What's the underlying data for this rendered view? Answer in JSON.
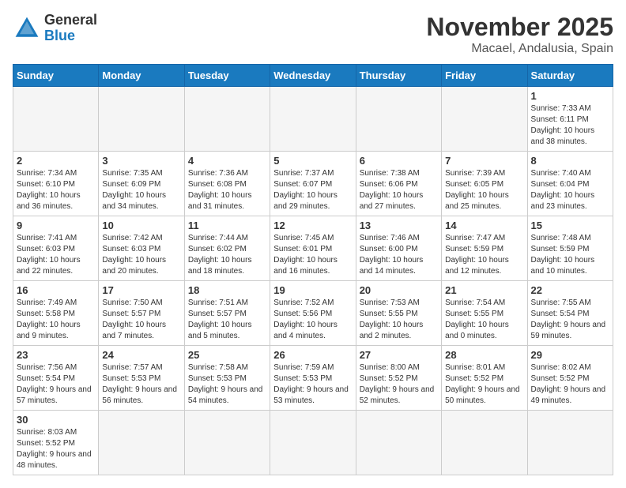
{
  "header": {
    "logo_general": "General",
    "logo_blue": "Blue",
    "month": "November 2025",
    "location": "Macael, Andalusia, Spain"
  },
  "weekdays": [
    "Sunday",
    "Monday",
    "Tuesday",
    "Wednesday",
    "Thursday",
    "Friday",
    "Saturday"
  ],
  "weeks": [
    [
      {
        "day": "",
        "info": ""
      },
      {
        "day": "",
        "info": ""
      },
      {
        "day": "",
        "info": ""
      },
      {
        "day": "",
        "info": ""
      },
      {
        "day": "",
        "info": ""
      },
      {
        "day": "",
        "info": ""
      },
      {
        "day": "1",
        "info": "Sunrise: 7:33 AM\nSunset: 6:11 PM\nDaylight: 10 hours and 38 minutes."
      }
    ],
    [
      {
        "day": "2",
        "info": "Sunrise: 7:34 AM\nSunset: 6:10 PM\nDaylight: 10 hours and 36 minutes."
      },
      {
        "day": "3",
        "info": "Sunrise: 7:35 AM\nSunset: 6:09 PM\nDaylight: 10 hours and 34 minutes."
      },
      {
        "day": "4",
        "info": "Sunrise: 7:36 AM\nSunset: 6:08 PM\nDaylight: 10 hours and 31 minutes."
      },
      {
        "day": "5",
        "info": "Sunrise: 7:37 AM\nSunset: 6:07 PM\nDaylight: 10 hours and 29 minutes."
      },
      {
        "day": "6",
        "info": "Sunrise: 7:38 AM\nSunset: 6:06 PM\nDaylight: 10 hours and 27 minutes."
      },
      {
        "day": "7",
        "info": "Sunrise: 7:39 AM\nSunset: 6:05 PM\nDaylight: 10 hours and 25 minutes."
      },
      {
        "day": "8",
        "info": "Sunrise: 7:40 AM\nSunset: 6:04 PM\nDaylight: 10 hours and 23 minutes."
      }
    ],
    [
      {
        "day": "9",
        "info": "Sunrise: 7:41 AM\nSunset: 6:03 PM\nDaylight: 10 hours and 22 minutes."
      },
      {
        "day": "10",
        "info": "Sunrise: 7:42 AM\nSunset: 6:03 PM\nDaylight: 10 hours and 20 minutes."
      },
      {
        "day": "11",
        "info": "Sunrise: 7:44 AM\nSunset: 6:02 PM\nDaylight: 10 hours and 18 minutes."
      },
      {
        "day": "12",
        "info": "Sunrise: 7:45 AM\nSunset: 6:01 PM\nDaylight: 10 hours and 16 minutes."
      },
      {
        "day": "13",
        "info": "Sunrise: 7:46 AM\nSunset: 6:00 PM\nDaylight: 10 hours and 14 minutes."
      },
      {
        "day": "14",
        "info": "Sunrise: 7:47 AM\nSunset: 5:59 PM\nDaylight: 10 hours and 12 minutes."
      },
      {
        "day": "15",
        "info": "Sunrise: 7:48 AM\nSunset: 5:59 PM\nDaylight: 10 hours and 10 minutes."
      }
    ],
    [
      {
        "day": "16",
        "info": "Sunrise: 7:49 AM\nSunset: 5:58 PM\nDaylight: 10 hours and 9 minutes."
      },
      {
        "day": "17",
        "info": "Sunrise: 7:50 AM\nSunset: 5:57 PM\nDaylight: 10 hours and 7 minutes."
      },
      {
        "day": "18",
        "info": "Sunrise: 7:51 AM\nSunset: 5:57 PM\nDaylight: 10 hours and 5 minutes."
      },
      {
        "day": "19",
        "info": "Sunrise: 7:52 AM\nSunset: 5:56 PM\nDaylight: 10 hours and 4 minutes."
      },
      {
        "day": "20",
        "info": "Sunrise: 7:53 AM\nSunset: 5:55 PM\nDaylight: 10 hours and 2 minutes."
      },
      {
        "day": "21",
        "info": "Sunrise: 7:54 AM\nSunset: 5:55 PM\nDaylight: 10 hours and 0 minutes."
      },
      {
        "day": "22",
        "info": "Sunrise: 7:55 AM\nSunset: 5:54 PM\nDaylight: 9 hours and 59 minutes."
      }
    ],
    [
      {
        "day": "23",
        "info": "Sunrise: 7:56 AM\nSunset: 5:54 PM\nDaylight: 9 hours and 57 minutes."
      },
      {
        "day": "24",
        "info": "Sunrise: 7:57 AM\nSunset: 5:53 PM\nDaylight: 9 hours and 56 minutes."
      },
      {
        "day": "25",
        "info": "Sunrise: 7:58 AM\nSunset: 5:53 PM\nDaylight: 9 hours and 54 minutes."
      },
      {
        "day": "26",
        "info": "Sunrise: 7:59 AM\nSunset: 5:53 PM\nDaylight: 9 hours and 53 minutes."
      },
      {
        "day": "27",
        "info": "Sunrise: 8:00 AM\nSunset: 5:52 PM\nDaylight: 9 hours and 52 minutes."
      },
      {
        "day": "28",
        "info": "Sunrise: 8:01 AM\nSunset: 5:52 PM\nDaylight: 9 hours and 50 minutes."
      },
      {
        "day": "29",
        "info": "Sunrise: 8:02 AM\nSunset: 5:52 PM\nDaylight: 9 hours and 49 minutes."
      }
    ],
    [
      {
        "day": "30",
        "info": "Sunrise: 8:03 AM\nSunset: 5:52 PM\nDaylight: 9 hours and 48 minutes."
      },
      {
        "day": "",
        "info": ""
      },
      {
        "day": "",
        "info": ""
      },
      {
        "day": "",
        "info": ""
      },
      {
        "day": "",
        "info": ""
      },
      {
        "day": "",
        "info": ""
      },
      {
        "day": "",
        "info": ""
      }
    ]
  ]
}
